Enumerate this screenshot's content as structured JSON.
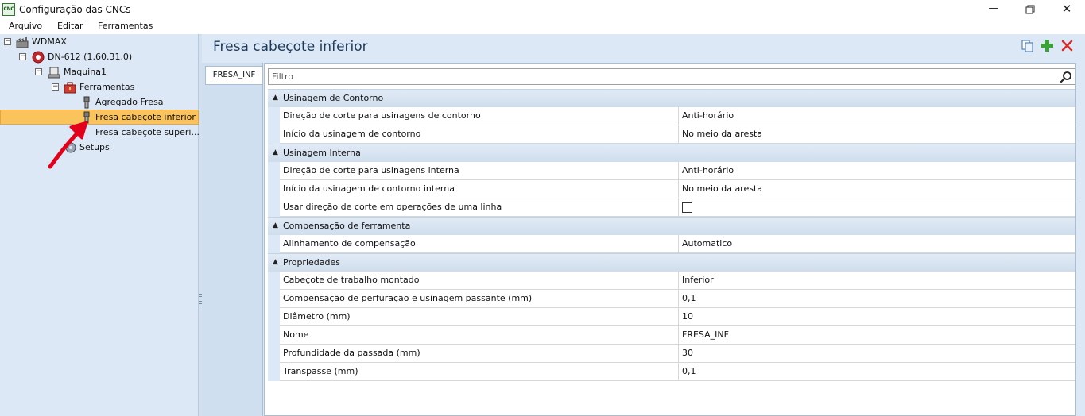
{
  "window": {
    "title": "Configuração das CNCs",
    "app_icon_text": "CNC"
  },
  "menu": [
    "Arquivo",
    "Editar",
    "Ferramentas"
  ],
  "tree": {
    "root": "WDMAX",
    "machine": "DN-612 (1.60.31.0)",
    "maquina": "Maquina1",
    "ferramentas": "Ferramentas",
    "tools": [
      "Agregado Fresa",
      "Fresa cabeçote inferior",
      "Fresa cabeçote superi..."
    ],
    "setups": "Setups",
    "selected": "Fresa cabeçote inferior"
  },
  "main": {
    "title": "Fresa cabeçote inferior",
    "tab": "FRESA_INF",
    "filter_placeholder": "Filtro",
    "categories": [
      {
        "label": "Usinagem de Contorno",
        "rows": [
          {
            "name": "Direção de corte para usinagens de contorno",
            "value": "Anti-horário"
          },
          {
            "name": "Início da usinagem de contorno",
            "value": "No meio da aresta"
          }
        ]
      },
      {
        "label": "Usinagem Interna",
        "rows": [
          {
            "name": "Direção de corte para usinagens interna",
            "value": "Anti-horário"
          },
          {
            "name": "Início da usinagem de contorno interna",
            "value": "No meio da aresta"
          },
          {
            "name": "Usar direção de corte em operações de uma linha",
            "value": ""
          }
        ]
      },
      {
        "label": "Compensação de ferramenta",
        "rows": [
          {
            "name": "Alinhamento de compensação",
            "value": "Automatico"
          }
        ]
      },
      {
        "label": "Propriedades",
        "rows": [
          {
            "name": "Cabeçote de trabalho montado",
            "value": "Inferior"
          },
          {
            "name": "Compensação de perfuração e usinagem passante (mm)",
            "value": "0,1"
          },
          {
            "name": "Diâmetro (mm)",
            "value": "10"
          },
          {
            "name": "Nome",
            "value": "FRESA_INF"
          },
          {
            "name": "Profundidade da passada (mm)",
            "value": "30"
          },
          {
            "name": "Transpasse (mm)",
            "value": "0,1"
          }
        ]
      }
    ]
  },
  "colors": {
    "selection": "#fbc35b",
    "panel": "#dce8f5",
    "arrow": "#e3001b",
    "add": "#3aa335",
    "delete": "#d92a2a"
  }
}
